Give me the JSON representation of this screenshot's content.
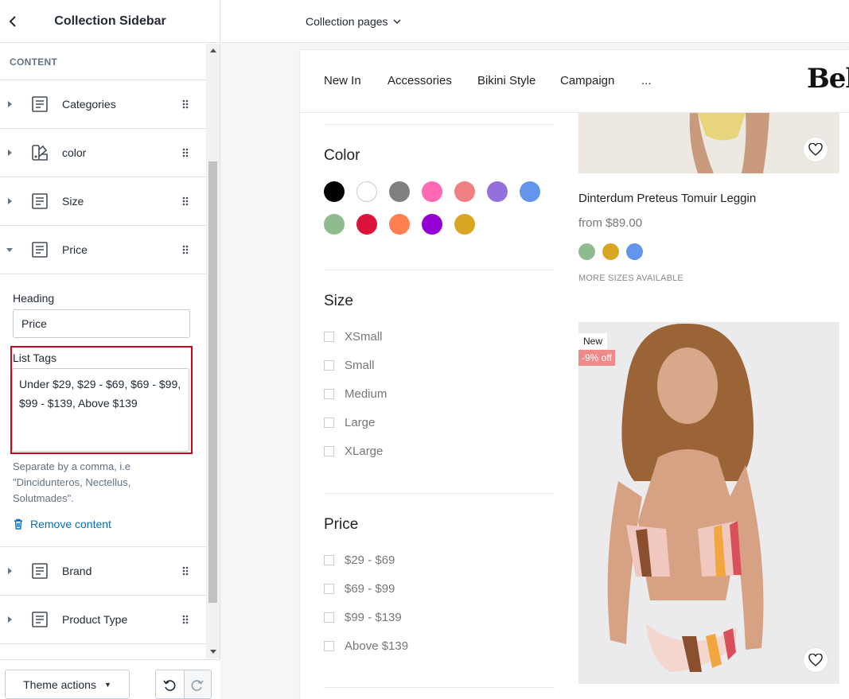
{
  "sidebar": {
    "title": "Collection Sidebar",
    "section_label": "CONTENT",
    "blocks_top": [
      {
        "label": "Categories",
        "icon": "text-block-icon"
      },
      {
        "label": "color",
        "icon": "color-swatch-icon"
      },
      {
        "label": "Size",
        "icon": "text-block-icon"
      },
      {
        "label": "Price",
        "icon": "text-block-icon",
        "expanded": true
      }
    ],
    "price_settings": {
      "heading_label": "Heading",
      "heading_value": "Price",
      "list_tags_label": "List Tags",
      "list_tags_value": "Under $29, $29 - $69, $69 - $99, $99 - $139, Above $139",
      "help_text": "Separate by a comma, i.e \"Dinciduntero­s, Nectellus, Solutmades\".",
      "remove_label": "Remove content"
    },
    "blocks_bottom": [
      {
        "label": "Brand",
        "icon": "text-block-icon"
      },
      {
        "label": "Product Type",
        "icon": "text-block-icon"
      }
    ],
    "footer": {
      "theme_actions_label": "Theme actions"
    }
  },
  "topbar": {
    "page_select_label": "Collection pages"
  },
  "preview": {
    "nav": [
      "New In",
      "Accessories",
      "Bikini Style",
      "Campaign",
      "..."
    ],
    "logo": "Bel",
    "filters": {
      "color_title": "Color",
      "colors": [
        "#000000",
        "#ffffff",
        "#808080",
        "#ff69b4",
        "#f08080",
        "#9370db",
        "#6495ed",
        "#8fbc8f",
        "#dc143c",
        "#ff7f50",
        "#9400d3",
        "#daa520"
      ],
      "size_title": "Size",
      "sizes": [
        "XSmall",
        "Small",
        "Medium",
        "Large",
        "XLarge"
      ],
      "price_title": "Price",
      "prices": [
        "$29 - $69",
        "$69 - $99",
        "$99 - $139",
        "Above $139"
      ]
    },
    "product1": {
      "title": "Dinterdum Preteus Tomuir Leggin",
      "price": "from $89.00",
      "swatches": [
        "#8fbc8f",
        "#daa520",
        "#6495ed"
      ],
      "sizes_note": "MORE SIZES AVAILABLE"
    },
    "product2": {
      "badge_new": "New",
      "badge_off": "-9% off"
    }
  }
}
